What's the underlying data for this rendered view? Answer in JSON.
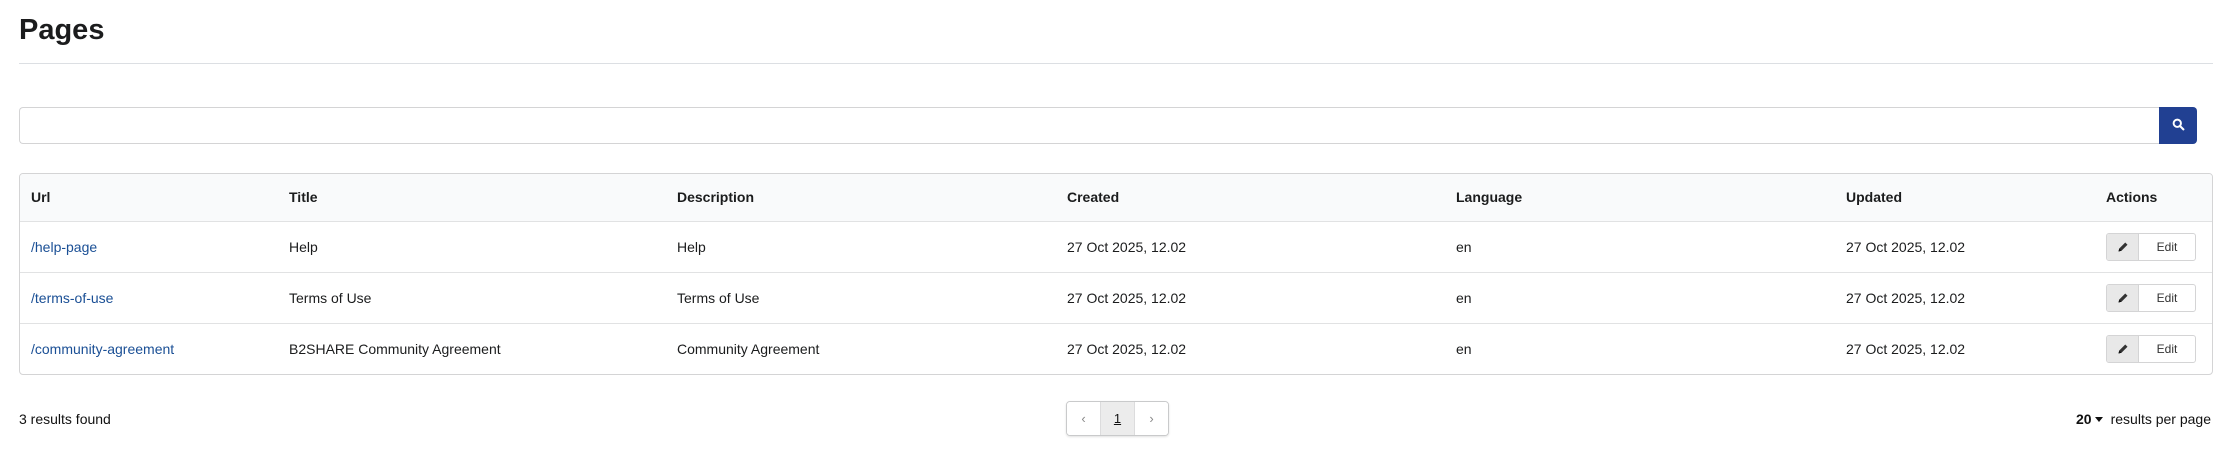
{
  "header": {
    "title": "Pages"
  },
  "search": {
    "value": "",
    "placeholder": "",
    "icon": "search-icon",
    "button_color": "#214092"
  },
  "table": {
    "columns": [
      "Url",
      "Title",
      "Description",
      "Created",
      "Language",
      "Updated",
      "Actions"
    ],
    "rows": [
      {
        "url": "/help-page",
        "title": "Help",
        "description": "Help",
        "created": "27 Oct 2025, 12.02",
        "language": "en",
        "updated": "27 Oct 2025, 12.02",
        "action_label": "Edit",
        "action_icon": "pencil-icon"
      },
      {
        "url": "/terms-of-use",
        "title": "Terms of Use",
        "description": "Terms of Use",
        "created": "27 Oct 2025, 12.02",
        "language": "en",
        "updated": "27 Oct 2025, 12.02",
        "action_label": "Edit",
        "action_icon": "pencil-icon"
      },
      {
        "url": "/community-agreement",
        "title": "B2SHARE Community Agreement",
        "description": "Community Agreement",
        "created": "27 Oct 2025, 12.02",
        "language": "en",
        "updated": "27 Oct 2025, 12.02",
        "action_label": "Edit",
        "action_icon": "pencil-icon"
      }
    ]
  },
  "footer": {
    "results_text": "3 results found",
    "pagination": {
      "prev": "‹",
      "current": "1",
      "next": "›"
    },
    "per_page": {
      "value": "20",
      "label": "results per page"
    }
  },
  "colors": {
    "link": "#1a4f95",
    "accent": "#214092"
  }
}
